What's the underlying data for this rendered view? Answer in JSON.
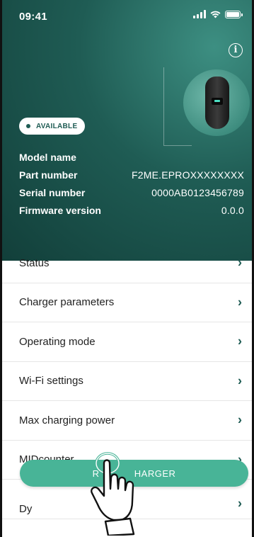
{
  "status_bar": {
    "time": "09:41"
  },
  "header": {
    "info_icon": "info-icon",
    "status_badge": "AVAILABLE",
    "specs": [
      {
        "label": "Model name",
        "value": ""
      },
      {
        "label": "Part number",
        "value": "F2ME.EPROXXXXXXXX"
      },
      {
        "label": "Serial number",
        "value": "0000AB0123456789"
      },
      {
        "label": "Firmware version",
        "value": "0.0.0"
      }
    ]
  },
  "menu": {
    "items": [
      {
        "label": "Status"
      },
      {
        "label": "Charger parameters"
      },
      {
        "label": "Operating mode"
      },
      {
        "label": "Wi-Fi settings"
      },
      {
        "label": "Max charging power"
      },
      {
        "label": "MIDcounter"
      },
      {
        "label": "Dy"
      }
    ]
  },
  "cta": {
    "label": "R            HARGER"
  },
  "colors": {
    "brand": "#1f5c54",
    "accent": "#48b497",
    "text": "#222222"
  }
}
